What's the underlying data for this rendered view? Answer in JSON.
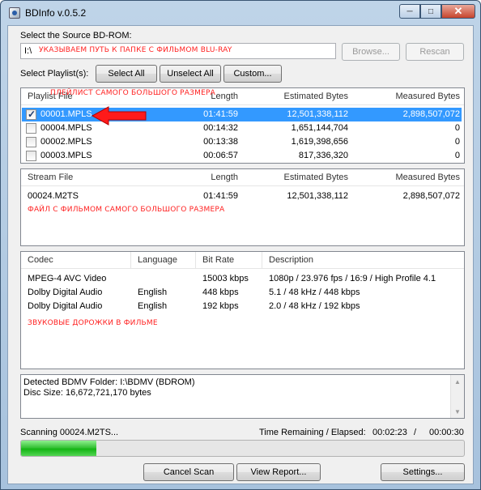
{
  "window": {
    "title": "BDInfo v.0.5.2"
  },
  "source": {
    "label": "Select the Source BD-ROM:",
    "path": "I:\\",
    "browse_label": "Browse...",
    "rescan_label": "Rescan",
    "annotation": "УКАЗЫВАЕМ ПУТЬ К ПАПКЕ С ФИЛЬМОМ BLU-RAY"
  },
  "playlists": {
    "label": "Select Playlist(s):",
    "select_all_label": "Select All",
    "unselect_all_label": "Unselect All",
    "custom_label": "Custom...",
    "annotation": "ПЛЕЙЛИСТ САМОГО БОЛЬШОГО РАЗМЕРА",
    "columns": [
      "Playlist File",
      "Length",
      "Estimated Bytes",
      "Measured Bytes"
    ],
    "rows": [
      {
        "file": "00001.MPLS",
        "length": "01:41:59",
        "estimated": "12,501,338,112",
        "measured": "2,898,507,072",
        "checked": true,
        "selected": true
      },
      {
        "file": "00004.MPLS",
        "length": "00:14:32",
        "estimated": "1,651,144,704",
        "measured": "0",
        "checked": false,
        "selected": false
      },
      {
        "file": "00002.MPLS",
        "length": "00:13:38",
        "estimated": "1,619,398,656",
        "measured": "0",
        "checked": false,
        "selected": false
      },
      {
        "file": "00003.MPLS",
        "length": "00:06:57",
        "estimated": "817,336,320",
        "measured": "0",
        "checked": false,
        "selected": false
      }
    ]
  },
  "streams": {
    "columns": [
      "Stream File",
      "Length",
      "Estimated Bytes",
      "Measured Bytes"
    ],
    "rows": [
      {
        "file": "00024.M2TS",
        "length": "01:41:59",
        "estimated": "12,501,338,112",
        "measured": "2,898,507,072"
      }
    ],
    "annotation": "ФАЙЛ С ФИЛЬМОМ САМОГО БОЛЬШОГО РАЗМЕРА"
  },
  "codecs": {
    "columns": [
      "Codec",
      "Language",
      "Bit Rate",
      "Description"
    ],
    "rows": [
      {
        "codec": "MPEG-4 AVC Video",
        "language": "",
        "bitrate": "15003 kbps",
        "description": "1080p / 23.976 fps / 16:9 / High Profile 4.1"
      },
      {
        "codec": "Dolby Digital Audio",
        "language": "English",
        "bitrate": "448 kbps",
        "description": "5.1 / 48 kHz / 448 kbps"
      },
      {
        "codec": "Dolby Digital Audio",
        "language": "English",
        "bitrate": "192 kbps",
        "description": "2.0 / 48 kHz / 192 kbps"
      }
    ],
    "annotation": "ЗВУКОВЫЕ ДОРОЖКИ В ФИЛЬМЕ"
  },
  "log": {
    "line1": "Detected BDMV Folder: I:\\BDMV (BDROM)",
    "line2": "Disc Size: 16,672,721,170 bytes"
  },
  "status": {
    "scanning": "Scanning 00024.M2TS...",
    "time_label": "Time Remaining / Elapsed:",
    "remaining": "00:02:23",
    "separator": "/",
    "elapsed": "00:00:30",
    "progress": 0.17
  },
  "buttons": {
    "cancel_scan": "Cancel Scan",
    "view_report": "View Report...",
    "settings": "Settings..."
  },
  "colors": {
    "selection": "#3399ff",
    "annotation": "#ff2020",
    "progress": "#22bb22"
  }
}
